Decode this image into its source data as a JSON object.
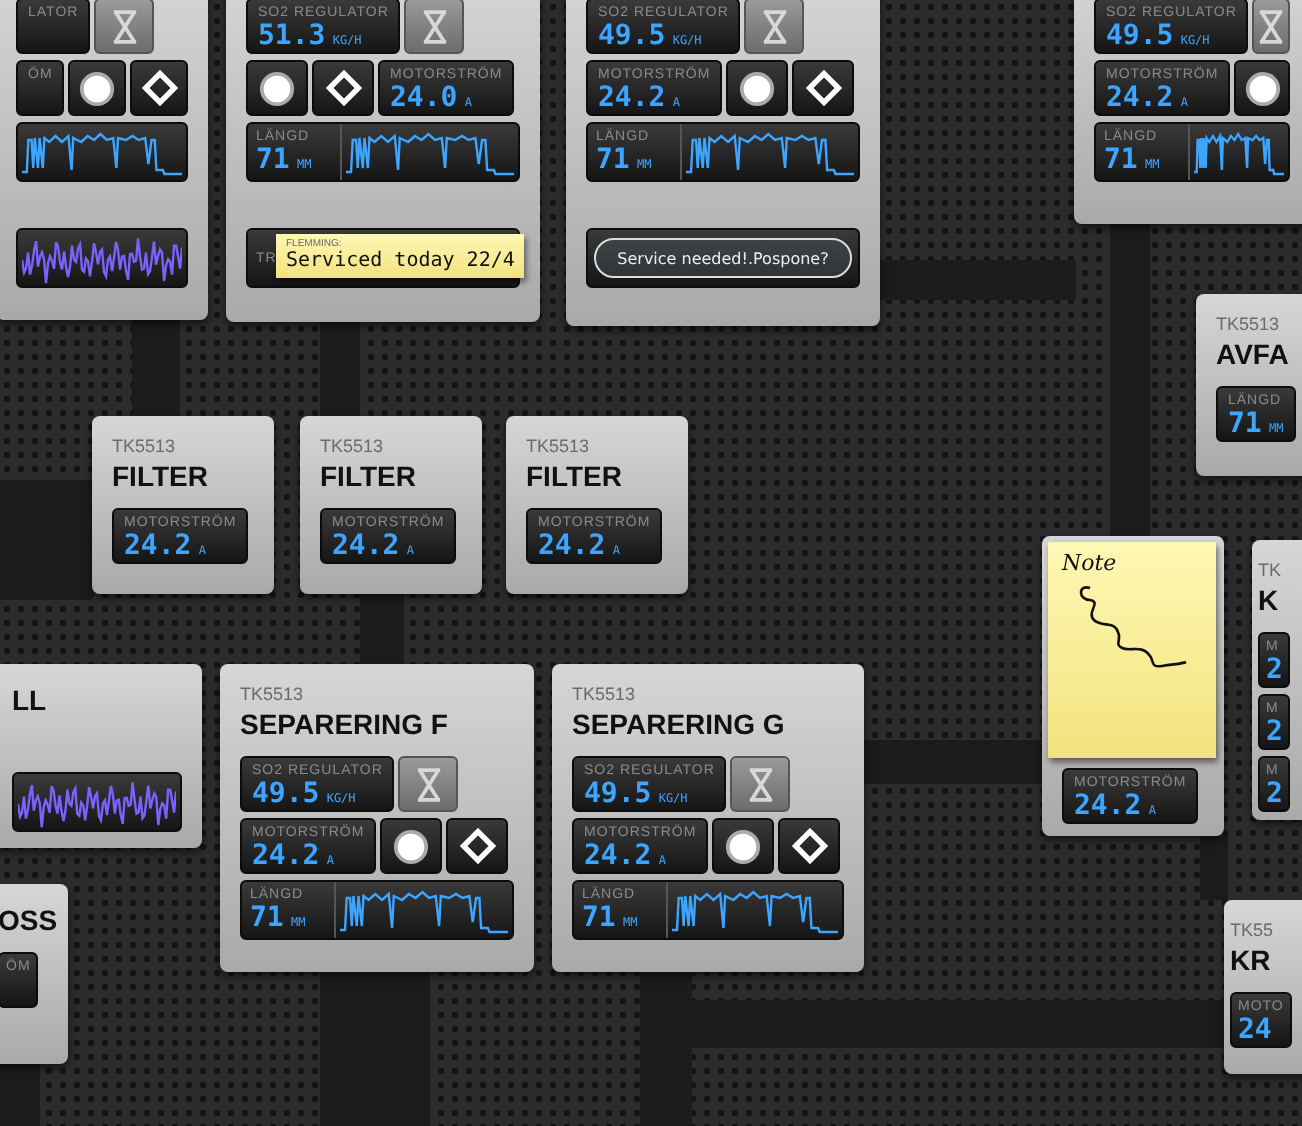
{
  "cards": [
    {
      "rows": [
        [
          {
            "kind": "readout",
            "label": "LATOR"
          },
          {
            "kind": "hourglass"
          }
        ],
        [
          {
            "kind": "readout",
            "label": "ÖM"
          },
          {
            "kind": "circle"
          },
          {
            "kind": "diamond"
          }
        ],
        [
          {
            "kind": "trend"
          }
        ],
        [
          {
            "kind": "wave"
          }
        ]
      ]
    },
    {
      "rows": [
        [
          {
            "kind": "readout",
            "label": "SO2 REGULATOR",
            "value": "51.3",
            "unit": "KG/H"
          },
          {
            "kind": "hourglass"
          }
        ],
        [
          {
            "kind": "circle"
          },
          {
            "kind": "diamond"
          },
          {
            "kind": "readout",
            "label": "MOTORSTRÖM",
            "value": "24.0",
            "unit": "A"
          }
        ],
        [
          {
            "kind": "trend",
            "label": "LÄNGD",
            "value": "71",
            "unit": "MM"
          }
        ],
        [
          {
            "kind": "trend-note",
            "label": "TR",
            "note_label": "FLEMMING:",
            "note_text": "Serviced today 22/4"
          }
        ]
      ]
    },
    {
      "rows": [
        [
          {
            "kind": "readout",
            "label": "SO2 REGULATOR",
            "value": "49.5",
            "unit": "KG/H"
          },
          {
            "kind": "hourglass"
          }
        ],
        [
          {
            "kind": "readout",
            "label": "MOTORSTRÖM",
            "value": "24.2",
            "unit": "A"
          },
          {
            "kind": "circle"
          },
          {
            "kind": "diamond"
          }
        ],
        [
          {
            "kind": "trend",
            "label": "LÄNGD",
            "value": "71",
            "unit": "MM"
          }
        ],
        [
          {
            "kind": "service",
            "text": "Service needed!.Pospone?"
          }
        ]
      ]
    },
    {
      "rows": [
        [
          {
            "kind": "readout",
            "label": "SO2 REGULATOR",
            "value": "49.5",
            "unit": "KG/H"
          },
          {
            "kind": "hourglass"
          }
        ],
        [
          {
            "kind": "readout",
            "label": "MOTORSTRÖM",
            "value": "24.2",
            "unit": "A"
          },
          {
            "kind": "circle"
          }
        ],
        [
          {
            "kind": "trend",
            "label": "LÄNGD",
            "value": "71",
            "unit": "MM"
          }
        ]
      ]
    },
    {
      "code": "TK5513",
      "title": "FILTER",
      "rows": [
        [
          {
            "kind": "readout",
            "label": "MOTORSTRÖM",
            "value": "24.2",
            "unit": "A"
          }
        ]
      ]
    },
    {
      "code": "TK5513",
      "title": "FILTER",
      "rows": [
        [
          {
            "kind": "readout",
            "label": "MOTORSTRÖM",
            "value": "24.2",
            "unit": "A"
          }
        ]
      ]
    },
    {
      "code": "TK5513",
      "title": "FILTER",
      "rows": [
        [
          {
            "kind": "readout",
            "label": "MOTORSTRÖM",
            "value": "24.2",
            "unit": "A"
          }
        ]
      ]
    },
    {
      "code": "TK5513",
      "title": "AVFA",
      "rows": [
        [
          {
            "kind": "readout",
            "label": "LÄNGD",
            "value": "71",
            "unit": "MM"
          }
        ]
      ]
    },
    {
      "title": "LL",
      "rows": [
        [
          {
            "kind": "wave"
          }
        ]
      ]
    },
    {
      "title": "OSS",
      "rows": [
        [
          {
            "kind": "readout",
            "label": "ÖM"
          }
        ]
      ]
    },
    {
      "code": "TK5513",
      "title": "SEPARERING F",
      "rows": [
        [
          {
            "kind": "readout",
            "label": "SO2 REGULATOR",
            "value": "49.5",
            "unit": "KG/H"
          },
          {
            "kind": "hourglass"
          }
        ],
        [
          {
            "kind": "readout",
            "label": "MOTORSTRÖM",
            "value": "24.2",
            "unit": "A"
          },
          {
            "kind": "circle"
          },
          {
            "kind": "diamond"
          }
        ],
        [
          {
            "kind": "trend",
            "label": "LÄNGD",
            "value": "71",
            "unit": "MM"
          }
        ]
      ]
    },
    {
      "code": "TK5513",
      "title": "SEPARERING G",
      "rows": [
        [
          {
            "kind": "readout",
            "label": "SO2 REGULATOR",
            "value": "49.5",
            "unit": "KG/H"
          },
          {
            "kind": "hourglass"
          }
        ],
        [
          {
            "kind": "readout",
            "label": "MOTORSTRÖM",
            "value": "24.2",
            "unit": "A"
          },
          {
            "kind": "circle"
          },
          {
            "kind": "diamond"
          }
        ],
        [
          {
            "kind": "trend",
            "label": "LÄNGD",
            "value": "71",
            "unit": "MM"
          }
        ]
      ]
    },
    {
      "rows": [
        [
          {
            "kind": "sticky-note",
            "text": "Note"
          }
        ],
        [
          {
            "kind": "readout",
            "label": "MOTORSTRÖM",
            "value": "24.2",
            "unit": "A"
          }
        ]
      ]
    },
    {
      "code": "TK",
      "title": "K",
      "rows": [
        [
          {
            "kind": "readout",
            "label": "M",
            "value": "2"
          }
        ],
        [
          {
            "kind": "readout",
            "label": "M",
            "value": "2"
          }
        ],
        [
          {
            "kind": "readout",
            "label": "M",
            "value": "2"
          }
        ]
      ]
    },
    {
      "code": "TK55",
      "title": "KR",
      "rows": [
        [
          {
            "kind": "readout",
            "label": "MOTO",
            "value": "24"
          }
        ]
      ]
    }
  ]
}
